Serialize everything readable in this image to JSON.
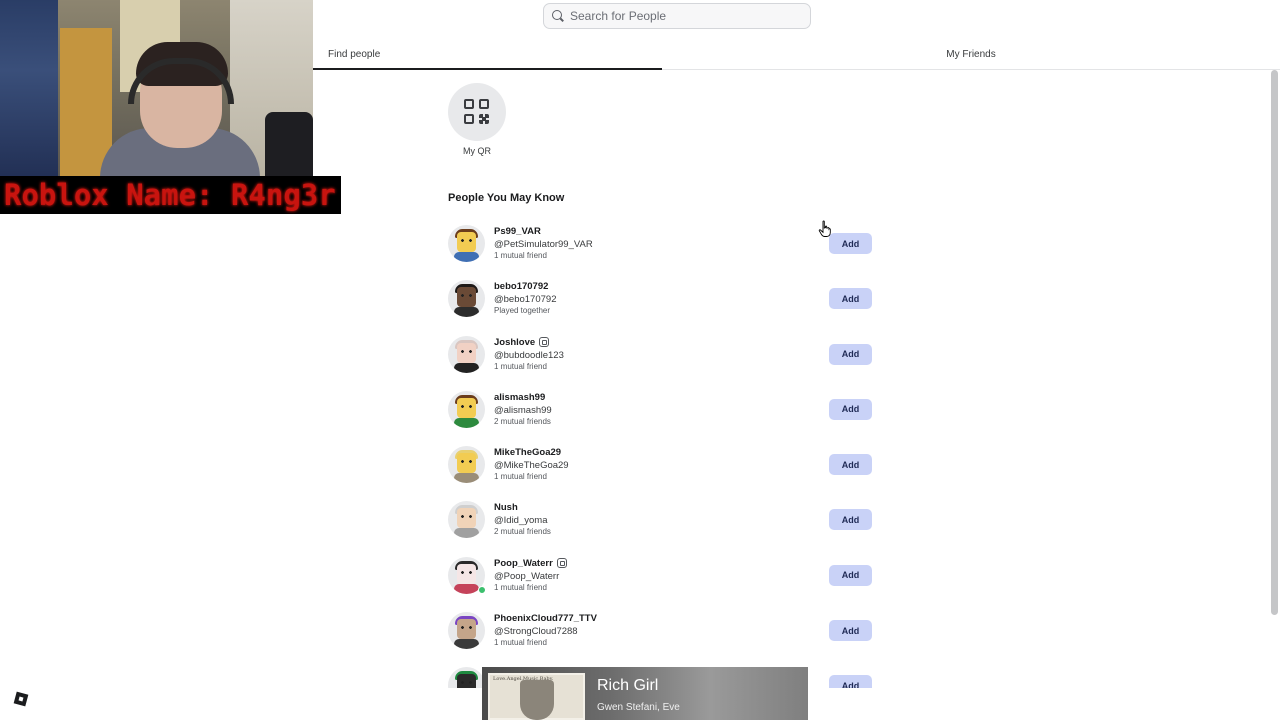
{
  "webcam": {
    "banner_text": "Roblox Name: R4ng3r"
  },
  "search": {
    "placeholder": "Search for People"
  },
  "tabs": [
    {
      "label": "Find people",
      "active": true
    },
    {
      "label": "My Friends",
      "active": false
    }
  ],
  "qr": {
    "label": "My QR"
  },
  "section_title": "People You May Know",
  "people": [
    {
      "name": "Ps99_VAR",
      "handle": "@PetSimulator99_VAR",
      "meta": "1 mutual friend",
      "verified": false,
      "online": false,
      "add_label": "Add"
    },
    {
      "name": "bebo170792",
      "handle": "@bebo170792",
      "meta": "Played together",
      "verified": false,
      "online": false,
      "add_label": "Add"
    },
    {
      "name": "Joshlove",
      "handle": "@bubdoodle123",
      "meta": "1 mutual friend",
      "verified": true,
      "online": false,
      "add_label": "Add"
    },
    {
      "name": "alismash99",
      "handle": "@alismash99",
      "meta": "2 mutual friends",
      "verified": false,
      "online": false,
      "add_label": "Add"
    },
    {
      "name": "MikeTheGoa29",
      "handle": "@MikeTheGoa29",
      "meta": "1 mutual friend",
      "verified": false,
      "online": false,
      "add_label": "Add"
    },
    {
      "name": "Nush",
      "handle": "@Idid_yoma",
      "meta": "2 mutual friends",
      "verified": false,
      "online": false,
      "add_label": "Add"
    },
    {
      "name": "Poop_Waterr",
      "handle": "@Poop_Waterr",
      "meta": "1 mutual friend",
      "verified": true,
      "online": true,
      "add_label": "Add"
    },
    {
      "name": "PhoenixCloud777_TTV",
      "handle": "@StrongCloud7288",
      "meta": "1 mutual friend",
      "verified": false,
      "online": false,
      "add_label": "Add"
    },
    {
      "name": "",
      "handle": "",
      "meta": "",
      "verified": false,
      "online": false,
      "add_label": "Add"
    }
  ],
  "avatar_styles": [
    {
      "face": "#f2cc52",
      "hair": "#6b3d1c",
      "torso": "#3f6fb4"
    },
    {
      "face": "#6a4a36",
      "hair": "#1e1a18",
      "torso": "#2c2c2c"
    },
    {
      "face": "#f1d1c4",
      "hair": "#d9c6c1",
      "torso": "#222222"
    },
    {
      "face": "#f2cc52",
      "hair": "#6b3d1c",
      "torso": "#2d8a3e"
    },
    {
      "face": "#f2cc52",
      "hair": "#e8d070",
      "torso": "#9a8d78"
    },
    {
      "face": "#f0d3b8",
      "hair": "#cfcfcf",
      "torso": "#a0a0a0"
    },
    {
      "face": "#f5e6e6",
      "hair": "#2a2a2a",
      "torso": "#c5435a"
    },
    {
      "face": "#c4a58a",
      "hair": "#7a45c2",
      "torso": "#3a3a3a"
    },
    {
      "face": "#2a2a2a",
      "hair": "#1e8a40",
      "torso": "#2a2a2a"
    }
  ],
  "music": {
    "title": "Rich Girl",
    "artist": "Gwen Stefani, Eve",
    "album_text": "Love.Angel.Music.Baby."
  }
}
